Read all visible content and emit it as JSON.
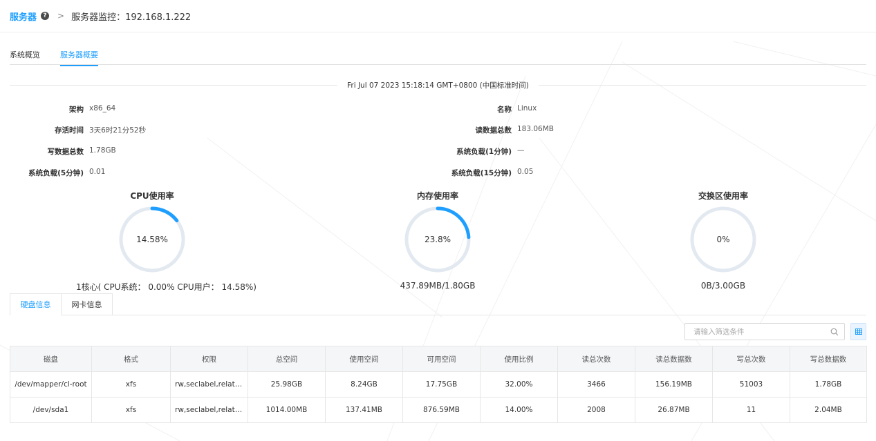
{
  "breadcrumb": {
    "root": "服务器",
    "separator": ">",
    "current": "服务器监控：192.168.1.222"
  },
  "tabs": [
    {
      "label": "系统概览",
      "active": false
    },
    {
      "label": "服务器概要",
      "active": true
    }
  ],
  "timestamp": "Fri Jul 07 2023 15:18:14 GMT+0800 (中国标准时间)",
  "info_left": [
    {
      "label": "架构",
      "value": "x86_64"
    },
    {
      "label": "存活时间",
      "value": "3天6时21分52秒"
    },
    {
      "label": "写数据总数",
      "value": "1.78GB"
    },
    {
      "label": "系统负载(5分钟)",
      "value": "0.01"
    }
  ],
  "info_right": [
    {
      "label": "名称",
      "value": "Linux"
    },
    {
      "label": "读数据总数",
      "value": "183.06MB"
    },
    {
      "label": "系统负载(1分钟)",
      "value": "—"
    },
    {
      "label": "系统负载(15分钟)",
      "value": "0.05"
    }
  ],
  "gauges": [
    {
      "title": "CPU使用率",
      "value_text": "14.58%",
      "percent": 14.58,
      "caption": "1核心( CPU系统： 0.00% CPU用户： 14.58%)"
    },
    {
      "title": "内存使用率",
      "value_text": "23.8%",
      "percent": 23.8,
      "caption": "437.89MB/1.80GB"
    },
    {
      "title": "交换区使用率",
      "value_text": "0%",
      "percent": 0,
      "caption": "0B/3.00GB"
    }
  ],
  "subtabs": [
    {
      "label": "硬盘信息",
      "active": true
    },
    {
      "label": "网卡信息",
      "active": false
    }
  ],
  "filter": {
    "placeholder": "请输入筛选条件"
  },
  "table": {
    "headers": [
      "磁盘",
      "格式",
      "权限",
      "总空间",
      "使用空间",
      "可用空间",
      "使用比例",
      "读总次数",
      "读总数据数",
      "写总次数",
      "写总数据数"
    ],
    "rows": [
      [
        "/dev/mapper/cl-root",
        "xfs",
        "rw,seclabel,relati...",
        "25.98GB",
        "8.24GB",
        "17.75GB",
        "32.00%",
        "3466",
        "156.19MB",
        "51003",
        "1.78GB"
      ],
      [
        "/dev/sda1",
        "xfs",
        "rw,seclabel,relati...",
        "1014.00MB",
        "137.41MB",
        "876.59MB",
        "14.00%",
        "2008",
        "26.87MB",
        "11",
        "2.04MB"
      ]
    ]
  },
  "colors": {
    "accent": "#1e9fff",
    "gauge_track": "#e3e9f0"
  }
}
